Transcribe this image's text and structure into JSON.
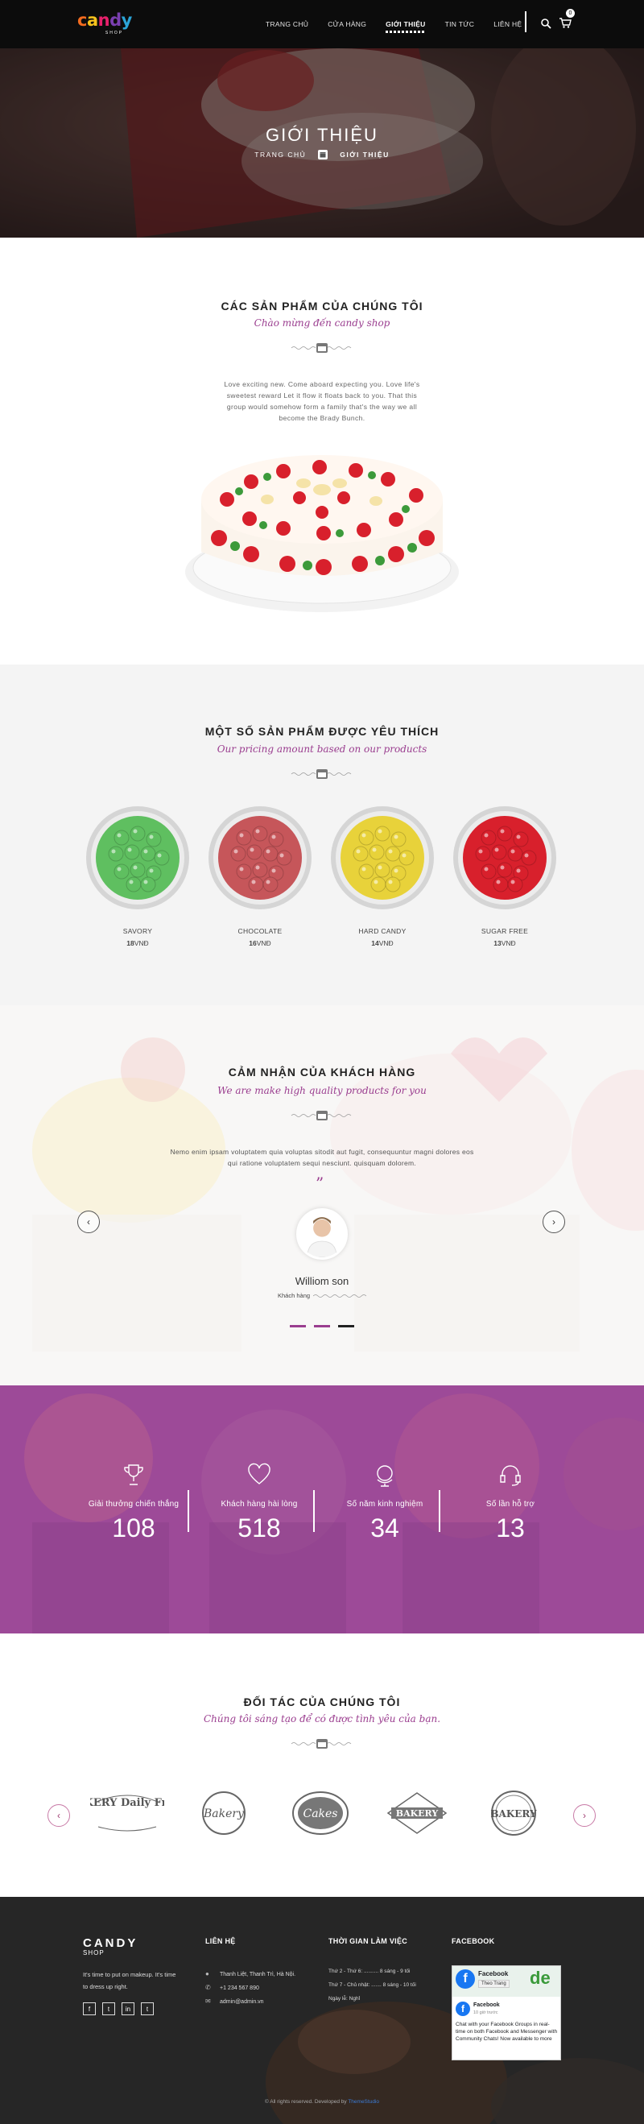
{
  "header": {
    "logo_text": "candy",
    "logo_sub": "SHOP",
    "nav": [
      "TRANG CHỦ",
      "CỬA HÀNG",
      "GIỚI THIỆU",
      "TIN TỨC",
      "LIÊN HỆ"
    ],
    "active_nav": "GIỚI THIỆU",
    "cart_count": "0"
  },
  "hero": {
    "title": "GIỚI THIỆU",
    "breadcrumb_home": "TRANG CHỦ",
    "breadcrumb_current": "GIỚI THIỆU"
  },
  "products_intro": {
    "title": "CÁC SẢN PHẨM CỦA CHÚNG TÔI",
    "subtitle": "Chào mừng đến candy shop",
    "text": "Love exciting new. Come aboard expecting you. Love life's sweetest reward Let it flow it floats back to you. That this group would somehow form a family that's the way we all become the Brady Bunch."
  },
  "favorites": {
    "title": "MỘT SỐ SẢN PHẨM ĐƯỢC YÊU THÍCH",
    "subtitle": "Our pricing amount based on our products",
    "items": [
      {
        "name": "SAVORY",
        "price": "18",
        "currency": "VNĐ",
        "color": "#5fbf60"
      },
      {
        "name": "CHOCOLATE",
        "price": "16",
        "currency": "VNĐ",
        "color": "#c6565a"
      },
      {
        "name": "HARD CANDY",
        "price": "14",
        "currency": "VNĐ",
        "color": "#e8d23a"
      },
      {
        "name": "SUGAR FREE",
        "price": "13",
        "currency": "VNĐ",
        "color": "#d8202c"
      }
    ]
  },
  "testimonial": {
    "title": "CẢM NHẬN CỦA KHÁCH HÀNG",
    "subtitle": "We are make high quality products for you",
    "text": "Nemo enim ipsam voluptatem quia voluptas sitodit aut fugit, consequuntur magni dolores eos qui ratione voluptatem sequi nesciunt. quisquam dolorem.",
    "quote_mark": "”",
    "name": "Williom son",
    "role": "Khách hàng"
  },
  "stats": [
    {
      "label": "Giải thưởng chiến thắng",
      "value": "108",
      "icon": "trophy-icon"
    },
    {
      "label": "Khách hàng hài lòng",
      "value": "518",
      "icon": "heart-icon"
    },
    {
      "label": "Số năm kinh nghiệm",
      "value": "34",
      "icon": "globe-icon"
    },
    {
      "label": "Số lần hỗ trợ",
      "value": "13",
      "icon": "headset-icon"
    }
  ],
  "partners": {
    "title": "ĐỐI TÁC CỦA CHÚNG TÔI",
    "subtitle": "Chúng tôi sáng tạo để có được tình yêu của bạn.",
    "logos": [
      "BAKERY Daily Fresh",
      "Bakery",
      "Cakes",
      "BAKERY",
      "BAKERY"
    ]
  },
  "footer": {
    "brand": "CANDY",
    "brand_sub": "SHOP",
    "about": "It's time to put on makeup. It's time to dress up right.",
    "contact_title": "LIÊN HỆ",
    "address": "Thanh Liệt, Thanh Trì, Hà Nội.",
    "phone": "+1 234 567 890",
    "email": "admin@admin.vn",
    "hours_title": "THỜI GIAN LÀM VIỆC",
    "hours": [
      "Thứ 2 - Thứ 6: .......... 8 sáng - 9 tối",
      "Thứ 7 - Chủ nhật: ....... 8 sáng - 10 tối",
      "Ngày lễ: Nghỉ"
    ],
    "facebook_title": "FACEBOOK",
    "fb_page_name": "Facebook",
    "fb_follow": "Theo Trang",
    "fb_post_name": "Facebook",
    "fb_post_time": "10 giờ trước",
    "fb_post_text": "Chat with your Facebook Groups in real-time on both Facebook and Messenger with Community Chats! Now available to more",
    "copyright": "© All rights reserved. Developed by",
    "developer": "ThemeStudio"
  }
}
